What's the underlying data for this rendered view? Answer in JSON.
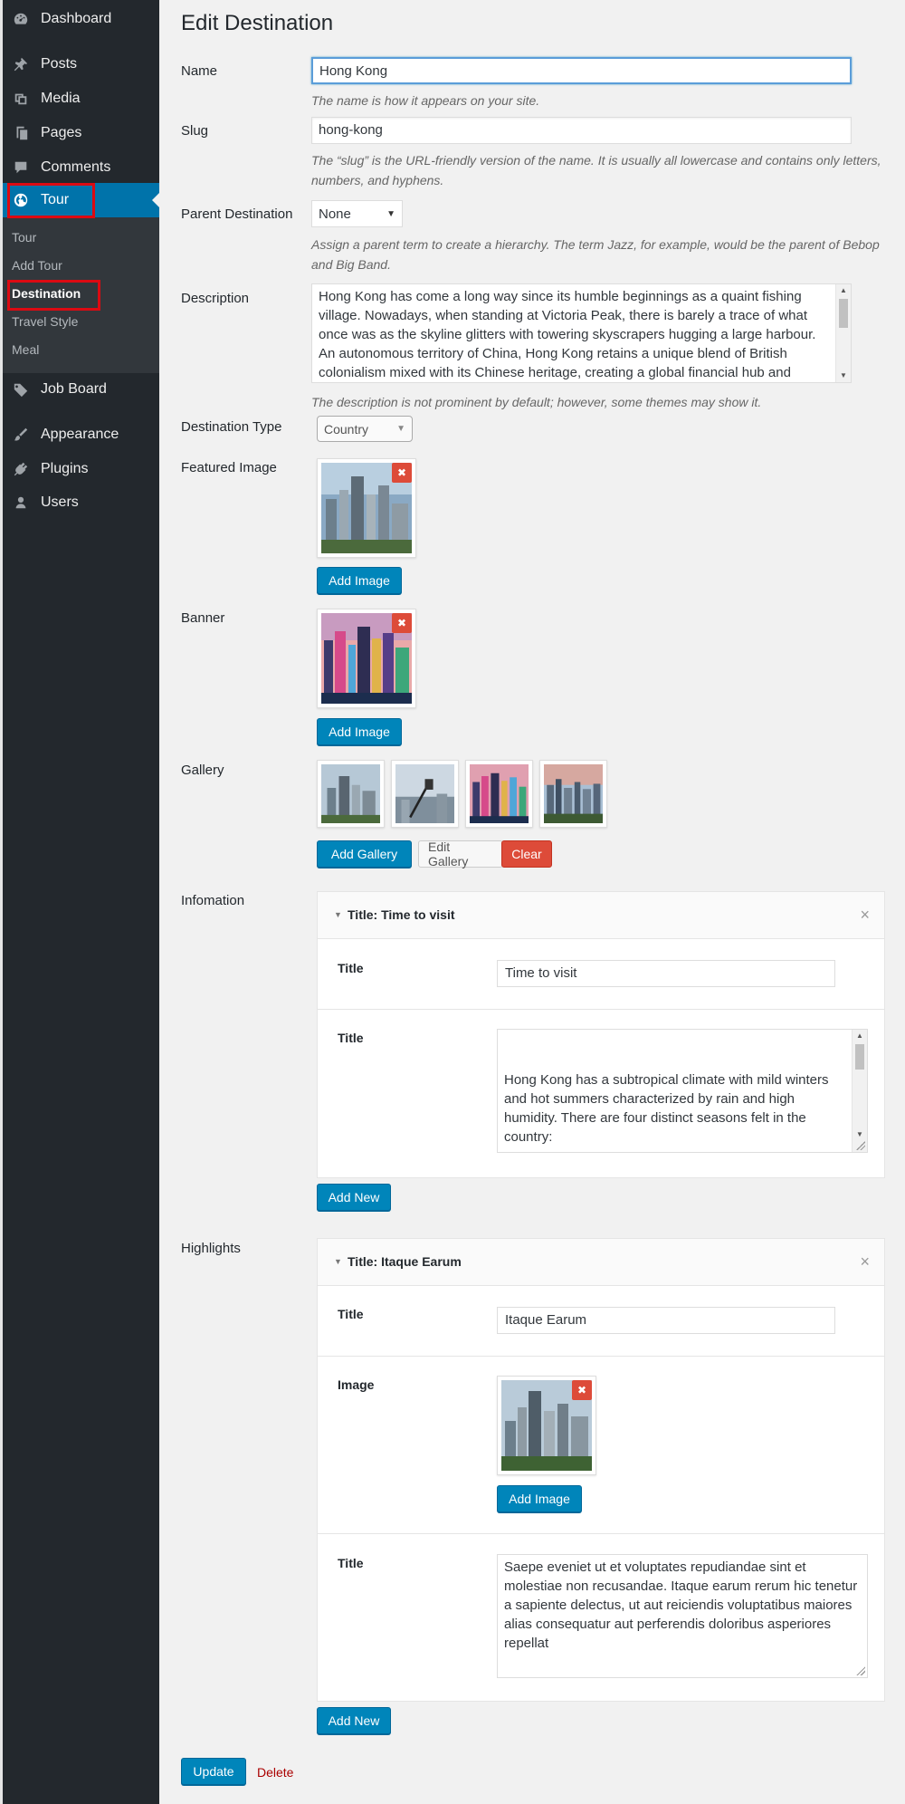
{
  "sidebar": {
    "menu": [
      {
        "label": "Dashboard",
        "icon": "dashboard-icon"
      },
      {
        "label": "Posts",
        "icon": "pushpin-icon"
      },
      {
        "label": "Media",
        "icon": "media-icon"
      },
      {
        "label": "Pages",
        "icon": "pages-icon"
      },
      {
        "label": "Comments",
        "icon": "comment-icon"
      },
      {
        "label": "Tour",
        "icon": "globe-icon"
      },
      {
        "label": "Job Board",
        "icon": "tag-icon"
      },
      {
        "label": "Appearance",
        "icon": "paintbrush-icon"
      },
      {
        "label": "Plugins",
        "icon": "plugin-icon"
      },
      {
        "label": "Users",
        "icon": "user-icon"
      }
    ],
    "submenu": [
      "Tour",
      "Add Tour",
      "Destination",
      "Travel Style",
      "Meal"
    ]
  },
  "page": {
    "title": "Edit Destination",
    "name": {
      "label": "Name",
      "value": "Hong Kong",
      "help": "The name is how it appears on your site."
    },
    "slug": {
      "label": "Slug",
      "value": "hong-kong",
      "help": "The “slug” is the URL-friendly version of the name. It is usually all lowercase and contains only letters, numbers, and hyphens."
    },
    "parent": {
      "label": "Parent Destination",
      "value": "None",
      "help": "Assign a parent term to create a hierarchy. The term Jazz, for example, would be the parent of Bebop and Big Band."
    },
    "description": {
      "label": "Description",
      "value": "Hong Kong has come a long way since its humble beginnings as a quaint fishing village. Nowadays, when standing at Victoria Peak, there is barely a trace of what once was as the skyline glitters with towering skyscrapers hugging a large harbour. An autonomous territory of China, Hong Kong retains a unique blend of British colonialism mixed with its Chinese heritage, creating a global financial hub and",
      "help": "The description is not prominent by default; however, some themes may show it."
    },
    "destination_type": {
      "label": "Destination Type",
      "value": "Country"
    },
    "featured_image": {
      "label": "Featured Image",
      "add_label": "Add Image"
    },
    "banner": {
      "label": "Banner",
      "add_label": "Add Image"
    },
    "gallery": {
      "label": "Gallery",
      "add_label": "Add Gallery",
      "edit_label": "Edit Gallery",
      "clear_label": "Clear"
    },
    "information": {
      "label": "Infomation",
      "item_header": "Title: Time to visit",
      "title_label": "Title",
      "title_value": "Time to visit",
      "text_label": "Title",
      "text_value": "Hong Kong has a subtropical climate with mild winters and hot summers characterized by rain and high humidity. There are four distinct seasons felt in the country:\n\nWinter (December to February) with cloudy skies and",
      "add_new": "Add New"
    },
    "highlights": {
      "label": "Highlights",
      "item_header": "Title: Itaque Earum",
      "title_label": "Title",
      "title_value": "Itaque Earum",
      "image_label": "Image",
      "image_add": "Add Image",
      "text_label": "Title",
      "text_value": "Saepe eveniet ut et voluptates repudiandae sint et molestiae non recusandae. Itaque earum rerum hic tenetur a sapiente delectus, ut aut reiciendis voluptatibus maiores alias consequatur aut perferendis doloribus asperiores repellat",
      "add_new": "Add New"
    },
    "update_label": "Update",
    "delete_label": "Delete"
  },
  "colors": {
    "sidebar_bg": "#23282d",
    "submenu_bg": "#32373c",
    "accent": "#0073aa",
    "primary_button": "#0085ba",
    "danger": "#dd4b39",
    "highlight_box": "#dc0a12"
  }
}
